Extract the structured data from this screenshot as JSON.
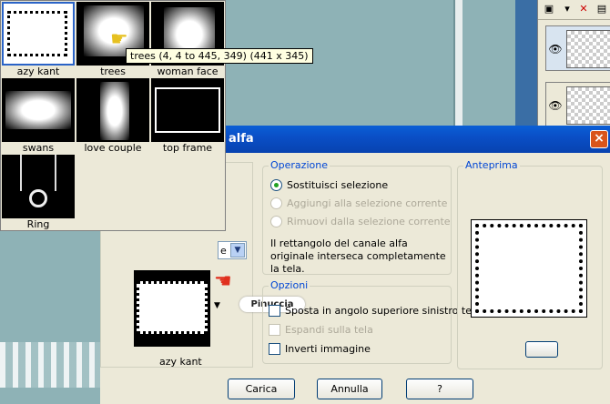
{
  "gallery": {
    "items": [
      {
        "name": "azy kant"
      },
      {
        "name": "trees"
      },
      {
        "name": "woman face"
      },
      {
        "name": "swans"
      },
      {
        "name": "love couple"
      },
      {
        "name": "top frame"
      },
      {
        "name": "Ring"
      }
    ],
    "tooltip": "trees  (4, 4 to 445, 349)  (441 x 345)"
  },
  "dialog": {
    "title": "alfa",
    "close": "×",
    "selected_channel": "azy kant",
    "combo_text": "e",
    "watermark": "Pinuccia",
    "operazione": {
      "legend": "Operazione",
      "options": [
        {
          "label": "Sostituisci selezione",
          "checked": true,
          "enabled": true
        },
        {
          "label": "Aggiungi alla selezione corrente",
          "checked": false,
          "enabled": false
        },
        {
          "label": "Rimuovi dalla selezione corrente",
          "checked": false,
          "enabled": false
        }
      ],
      "info": "Il rettangolo del canale alfa originale interseca completamente la tela."
    },
    "opzioni": {
      "legend": "Opzioni",
      "options": [
        {
          "label": "Sposta in angolo superiore sinistro tela",
          "checked": false,
          "enabled": true
        },
        {
          "label": "Espandi sulla tela",
          "checked": false,
          "enabled": false
        },
        {
          "label": "Inverti immagine",
          "checked": false,
          "enabled": true
        }
      ]
    },
    "anteprima": {
      "legend": "Anteprima"
    },
    "buttons": {
      "load": "Carica",
      "cancel": "Annulla",
      "help": "?"
    }
  },
  "icons": {
    "hand": "pointing-hand-icon",
    "eye": "eye-icon",
    "close": "close-icon"
  }
}
